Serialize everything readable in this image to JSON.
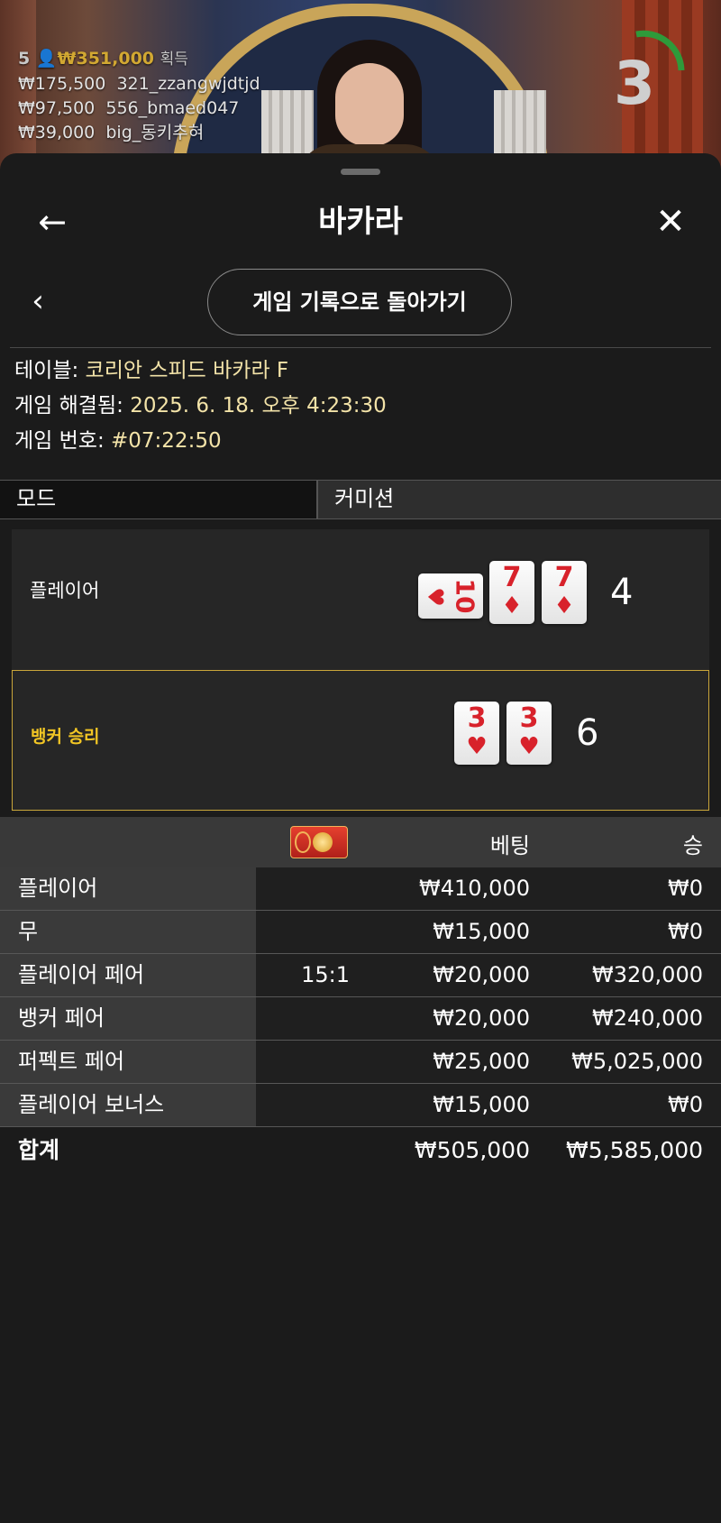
{
  "live": {
    "winners_count": "5",
    "winners_total": "₩351,000",
    "winners_suffix": "획득",
    "winners": [
      {
        "amount": "₩175,500",
        "user": "321_zzangwjdtjd"
      },
      {
        "amount": "₩97,500",
        "user": "556_bmaed047"
      },
      {
        "amount": "₩39,000",
        "user": "big_동키추혀"
      }
    ],
    "timer": "3"
  },
  "header": {
    "title": "바카라",
    "back_history_label": "게임 기록으로 돌아가기"
  },
  "info": {
    "table_label": "테이블:",
    "table_value": "코리안 스피드 바카라 F",
    "resolved_label": "게임 해결됨:",
    "resolved_value": "2025. 6. 18. 오후 4:23:30",
    "number_label": "게임 번호:",
    "number_value": "#07:22:50"
  },
  "mode": {
    "label": "모드",
    "value": "커미션"
  },
  "result": {
    "player": {
      "label": "플레이어",
      "score": "4",
      "cards": [
        {
          "rank": "10",
          "suit": "♥",
          "rotated": true
        },
        {
          "rank": "7",
          "suit": "♦",
          "rotated": false
        },
        {
          "rank": "7",
          "suit": "♦",
          "rotated": false
        }
      ]
    },
    "banker": {
      "label": "뱅커 승리",
      "score": "6",
      "cards": [
        {
          "rank": "3",
          "suit": "♥",
          "rotated": false
        },
        {
          "rank": "3",
          "suit": "♥",
          "rotated": false
        }
      ]
    }
  },
  "bets": {
    "header_bet": "베팅",
    "header_win": "승",
    "rows": [
      {
        "name": "플레이어",
        "payout": "",
        "bet": "₩410,000",
        "win": "₩0"
      },
      {
        "name": "무",
        "payout": "",
        "bet": "₩15,000",
        "win": "₩0"
      },
      {
        "name": "플레이어 페어",
        "payout": "15:1",
        "bet": "₩20,000",
        "win": "₩320,000"
      },
      {
        "name": "뱅커 페어",
        "payout": "",
        "bet": "₩20,000",
        "win": "₩240,000"
      },
      {
        "name": "퍼펙트 페어",
        "payout": "",
        "bet": "₩25,000",
        "win": "₩5,025,000"
      },
      {
        "name": "플레이어 보너스",
        "payout": "",
        "bet": "₩15,000",
        "win": "₩0"
      }
    ],
    "total_label": "합계",
    "total_bet": "₩505,000",
    "total_win": "₩5,585,000"
  },
  "colors": {
    "accent_gold": "#f2c624",
    "info_value": "#f3e3a8",
    "timer_arc": "#2e9a3a",
    "card_red": "#d8222b"
  },
  "icons": {
    "back": "arrow-left-icon",
    "close": "close-icon",
    "chevron": "chevron-left-icon",
    "chip": "red-envelope-icon"
  }
}
